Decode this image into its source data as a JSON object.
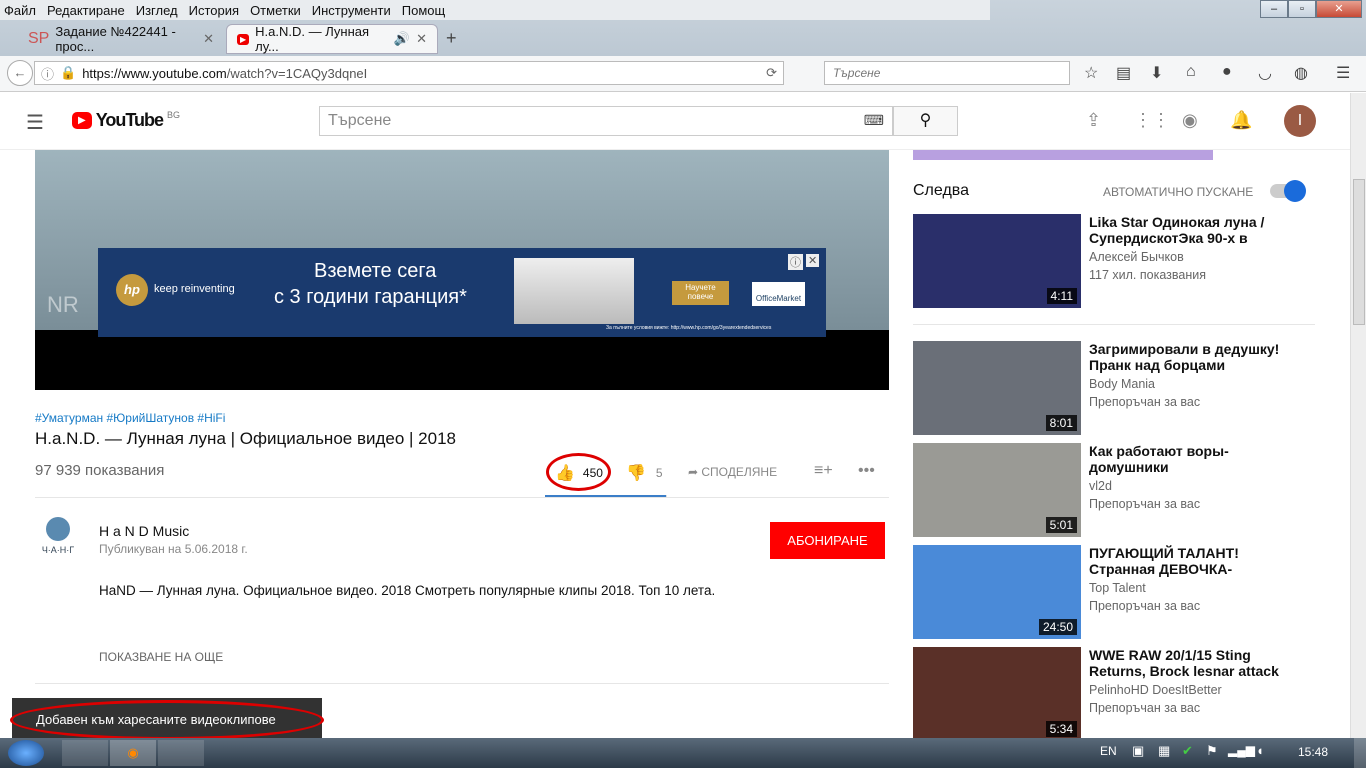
{
  "browser": {
    "menu": [
      "Файл",
      "Редактиране",
      "Изглед",
      "История",
      "Отметки",
      "Инструменти",
      "Помощ"
    ],
    "tabs": [
      {
        "label": "Задание №422441 - прос...",
        "icon": "SP"
      },
      {
        "label": "H.a.N.D. — Лунная лу..."
      }
    ],
    "url_host": "https://www.youtube.com",
    "url_path": "/watch?v=1CAQy3dqneI",
    "search_placeholder": "Търсене"
  },
  "youtube": {
    "logo": "YouTube",
    "region": "BG",
    "search_placeholder": "Търсене",
    "avatar_letter": "I",
    "ad": {
      "brand": "keep reinventing",
      "line1": "Вземете сега",
      "line2": "с 3 години гаранция*",
      "cta": "Научете повече",
      "partner": "OfficeMarket",
      "fine": "За пълните условия вижте: http://www.hp.com/go/3yearextendedservices",
      "watermark": "NR"
    },
    "video": {
      "hashtags": "#Уматурман #ЮрийШатунов #HiFi",
      "title": "H.a.N.D. — Лунная луна | Официальное видео | 2018",
      "views": "97 939 показвания",
      "likes": "450",
      "dislikes": "5",
      "share": "СПОДЕЛЯНЕ",
      "like_fraction": 0.989
    },
    "channel": {
      "name": "H a N D Music",
      "published": "Публикуван на 5.06.2018 г.",
      "logo_text": "Ч·А·Н·Г",
      "subscribe": "АБОНИРАНЕ",
      "description": "HaND — Лунная луна. Официальное видео. 2018 Смотреть популярные клипы 2018. Топ 10 лета.",
      "show_more": "ПОКАЗВАНЕ НА ОЩЕ"
    },
    "toast": "Добавен към харесаните видеоклипове",
    "up_next": "Следва",
    "autoplay": "АВТОМАТИЧНО ПУСКАНЕ",
    "suggestions": [
      {
        "title": "Lika Star Одинокая луна / СупердискотЭка 90-х в",
        "channel": "Алексей Бычков",
        "meta": "117 хил. показвания",
        "duration": "4:11",
        "color": "#2a2f6a"
      },
      {
        "title": "Загримировали в дедушку! Пранк над борцами",
        "channel": "Body Mania",
        "meta": "Препоръчан за вас",
        "duration": "8:01",
        "color": "#6a6f78"
      },
      {
        "title": "Как работают воры-домушники",
        "channel": "vl2d",
        "meta": "Препоръчан за вас",
        "duration": "5:01",
        "color": "#9a9a95"
      },
      {
        "title": "ПУГАЮЩИЙ ТАЛАНТ! Странная ДЕВОЧКА-",
        "channel": "Top Talent",
        "meta": "Препоръчан за вас",
        "duration": "24:50",
        "color": "#4a8ad8"
      },
      {
        "title": "WWE RAW 20/1/15 Sting Returns, Brock lesnar attack",
        "channel": "PelinhoHD DoesItBetter",
        "meta": "Препоръчан за вас",
        "duration": "5:34",
        "color": "#5a3028"
      }
    ]
  },
  "taskbar": {
    "lang": "EN",
    "time": "15:48"
  }
}
